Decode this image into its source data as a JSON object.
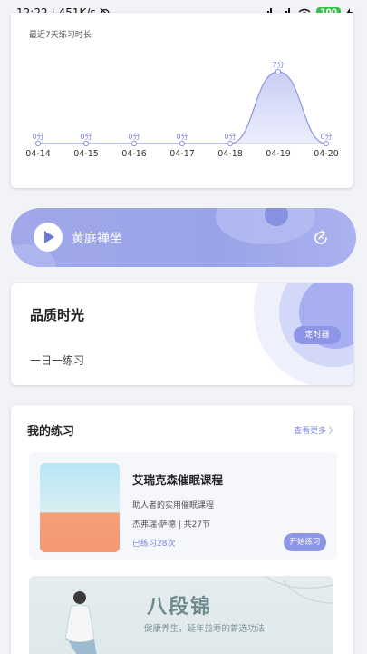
{
  "status_bar": {
    "time": "12:22",
    "speed": "451K/s",
    "battery": "100"
  },
  "chart_card": {
    "title": "最近7天练习时长"
  },
  "chart_data": {
    "type": "area",
    "title": "最近7天练习时长",
    "categories": [
      "04-14",
      "04-15",
      "04-16",
      "04-17",
      "04-18",
      "04-19",
      "04-20"
    ],
    "values": [
      0,
      0,
      0,
      0,
      0,
      7,
      0
    ],
    "value_labels": [
      "0分",
      "0分",
      "0分",
      "0分",
      "0分",
      "7分",
      "0分"
    ],
    "xlabel": "",
    "ylabel": "",
    "ylim": [
      0,
      7
    ],
    "grid": false,
    "color": "#8e97e0"
  },
  "meditate": {
    "label": "黄庭禅坐",
    "icon": "play-icon"
  },
  "quality": {
    "title": "品质时光",
    "subtitle": "一日一练习",
    "timer_button": "定时器"
  },
  "practice": {
    "title": "我的练习",
    "see_more": "查看更多 〉",
    "course": {
      "title": "艾瑞克森催眠课程",
      "desc": "助人者的实用催眠课程",
      "meta": "杰弗瑞·萨德 | 共27节",
      "done": "已练习28次",
      "start_button": "开始练习"
    },
    "banner": {
      "title": "八段锦",
      "subtitle": "健康养生，延年益寿的首选功法"
    }
  },
  "colors": {
    "accent": "#8c95e6",
    "text": "#222222"
  }
}
